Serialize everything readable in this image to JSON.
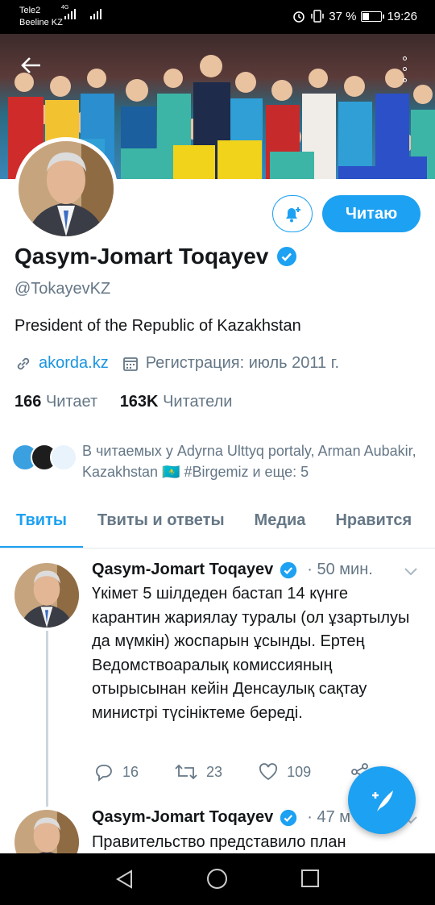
{
  "status_bar": {
    "carrier_1": "Tele2",
    "carrier_2": "Beeline KZ",
    "network_1": "4G",
    "battery_percent": "37 %",
    "battery_level": 0.37,
    "time": "19:26"
  },
  "profile": {
    "name": "Qasym-Jomart Toqayev",
    "verified": true,
    "handle": "@TokayevKZ",
    "bio": "President of the Republic of Kazakhstan",
    "website": "akorda.kz",
    "joined": "Регистрация: июль 2011 г.",
    "following_count": "166",
    "following_label": "Читает",
    "followers_count": "163K",
    "followers_label": "Читатели",
    "followed_by_text": "В читаемых у Adyrna Ulttyq portaly, Arman Aubakir, Kazakhstan 🇰🇿 #Birgemiz и еще: 5",
    "follow_button": "Читаю",
    "accent": "#1da1f2"
  },
  "tabs": [
    {
      "label": "Твиты",
      "active": true
    },
    {
      "label": "Твиты и ответы",
      "active": false
    },
    {
      "label": "Медиа",
      "active": false
    },
    {
      "label": "Нравится",
      "active": false
    }
  ],
  "tweets": [
    {
      "author": "Qasym-Jomart Toqayev",
      "time": "· 50 мин.",
      "text": "Үкімет 5 шілдеден бастап 14 күнге карантин жариялау туралы (ол ұзартылуы да мүмкін) жоспарын ұсынды. Ертең Ведомствоаралық комиссияның отырысынан кейін Денсаулық сақтау министрі түсініктеме береді.",
      "replies": "16",
      "retweets": "23",
      "likes": "109"
    },
    {
      "author": "Qasym-Jomart Toqayev",
      "time": "· 47 м",
      "text": "Правительство представило план"
    }
  ]
}
